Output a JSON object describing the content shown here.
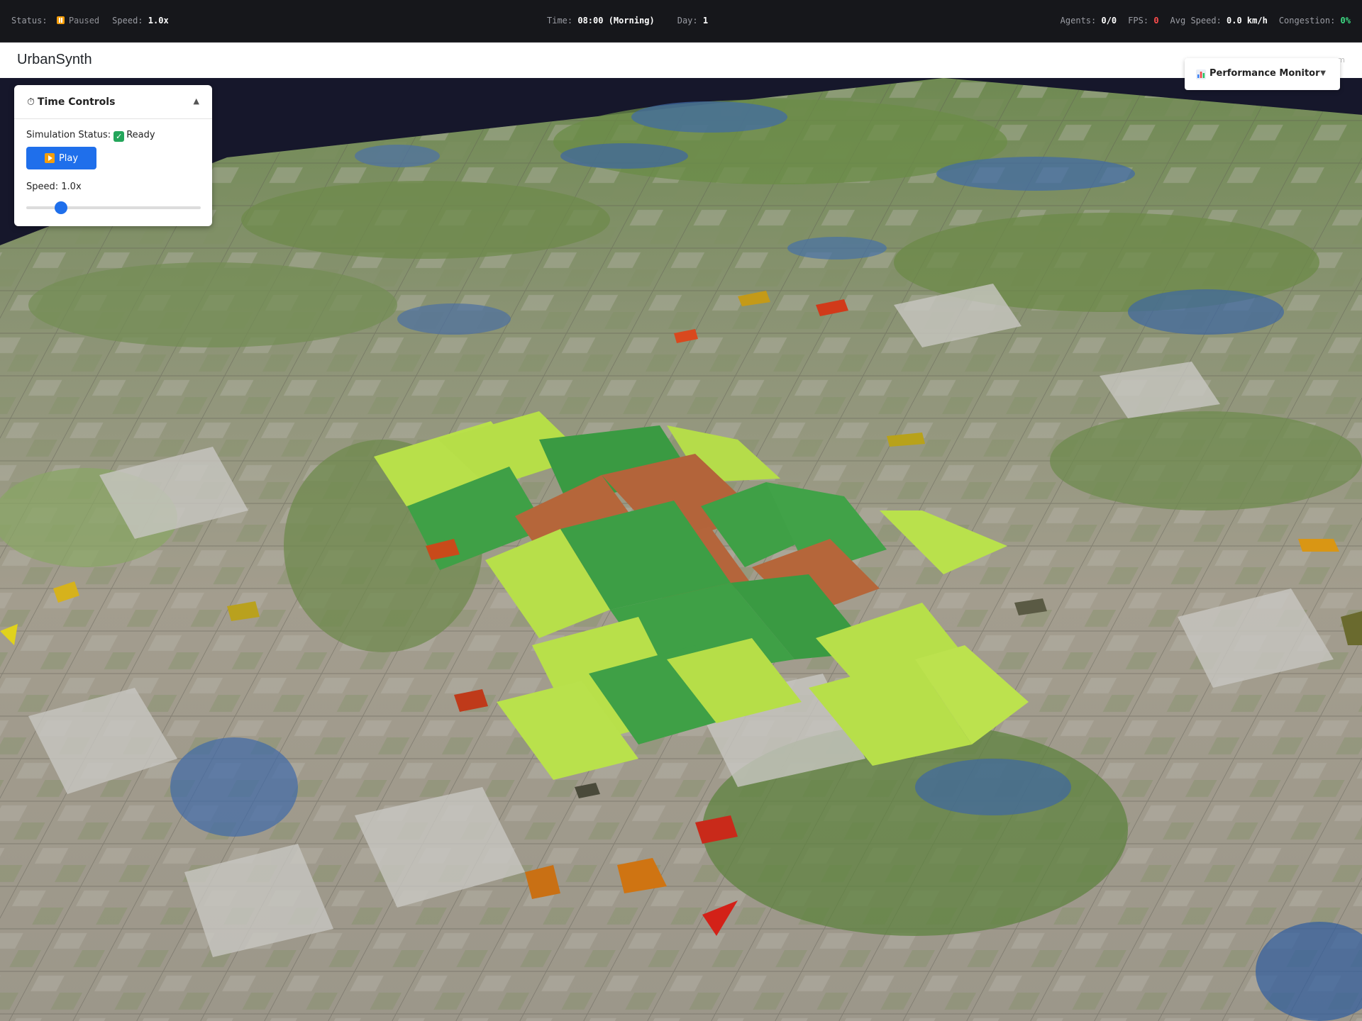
{
  "status_bar": {
    "status_label": "Status:",
    "status_value": "Paused",
    "speed_label": "Speed:",
    "speed_value": "1.0x",
    "time_label": "Time:",
    "time_value": "08:00 (Morning)",
    "day_label": "Day:",
    "day_value": "1",
    "agents_label": "Agents:",
    "agents_value": "0/0",
    "fps_label": "FPS:",
    "fps_value": "0",
    "avg_speed_label": "Avg Speed:",
    "avg_speed_value": "0.0 km/h",
    "congestion_label": "Congestion:",
    "congestion_value": "0%"
  },
  "header": {
    "title": "UrbanSynth",
    "clipped_text": "m"
  },
  "time_controls": {
    "title": "Time Controls",
    "icon": "stopwatch-icon",
    "collapse_glyph": "▲",
    "status_label": "Simulation Status:",
    "status_value": "Ready",
    "play_label": "Play",
    "speed_label": "Speed: 1.0x",
    "speed_slider_fraction": 0.2
  },
  "performance_monitor": {
    "label": "Performance Monitor",
    "icon": "bar-chart-icon",
    "caret": "▼"
  },
  "scene": {
    "sky_color": "#16172b",
    "ground_color": "#9a9586",
    "highlight_colors": {
      "low": "#b8e04a",
      "mid": "#3fa046",
      "high": "#b5663a"
    }
  }
}
